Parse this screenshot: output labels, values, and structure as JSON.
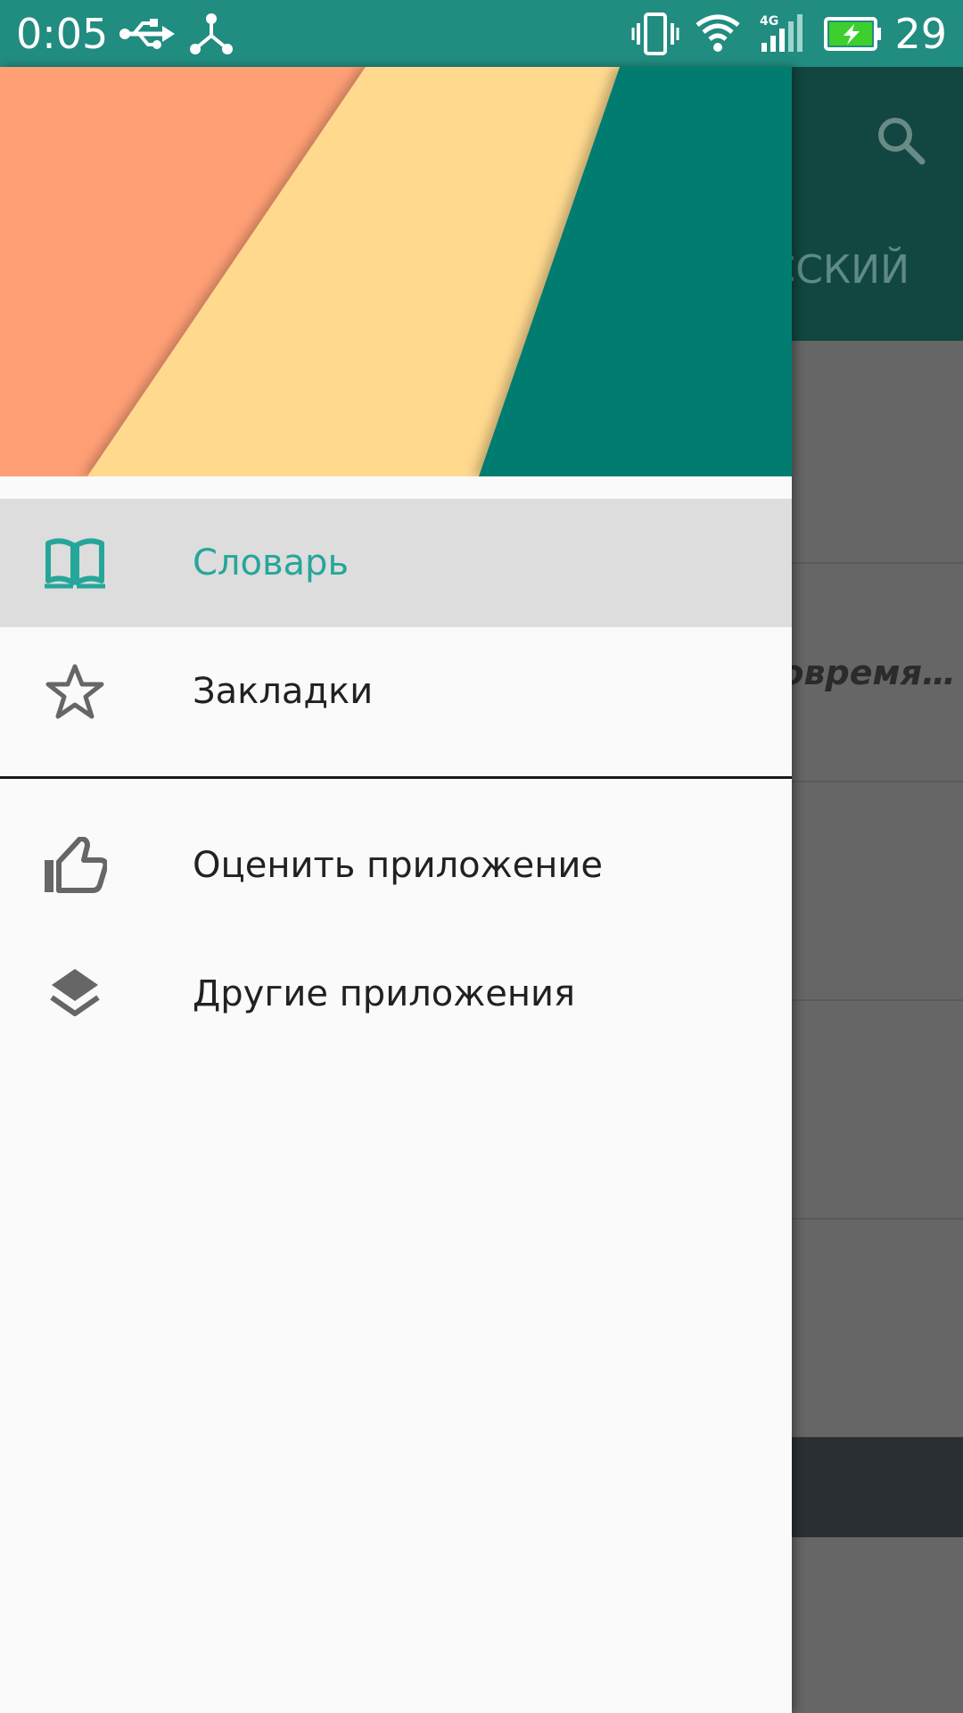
{
  "status_bar": {
    "time": "0:05",
    "battery_level": "29",
    "icons": [
      "usb-icon",
      "share-icon",
      "vibrate-icon",
      "wifi-icon",
      "signal-4g-icon",
      "battery-charging-icon"
    ]
  },
  "app": {
    "tab_label": "ССКИЙ",
    "list_snippet": "вовремя…"
  },
  "drawer": {
    "items": [
      {
        "label": "Словарь",
        "icon": "book-icon",
        "active": true
      },
      {
        "label": "Закладки",
        "icon": "star-icon",
        "active": false
      },
      {
        "label": "Оценить приложение",
        "icon": "thumbs-up-icon",
        "active": false
      },
      {
        "label": "Другие приложения",
        "icon": "layers-icon",
        "active": false
      }
    ]
  },
  "colors": {
    "status_bar": "#218c80",
    "accent": "#26a69a",
    "header_coral": "#ff9f75",
    "header_yellow": "#ffd98e",
    "header_teal": "#007b70"
  }
}
